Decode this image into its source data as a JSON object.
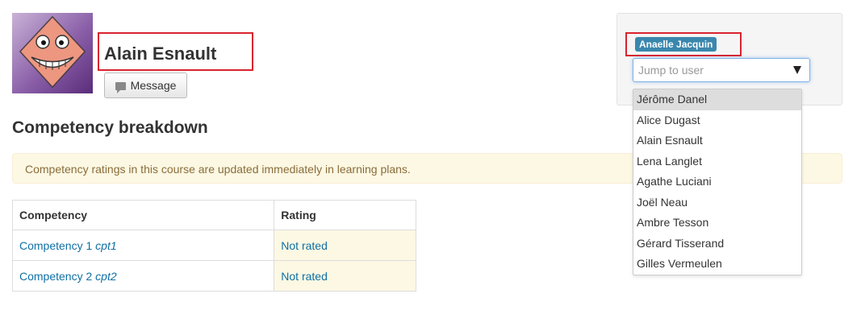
{
  "user": {
    "name": "Alain Esnault"
  },
  "message_button": {
    "label": "Message"
  },
  "section_title": "Competency breakdown",
  "alert_text": "Competency ratings in this course are updated immediately in learning plans.",
  "table": {
    "headers": [
      "Competency",
      "Rating"
    ],
    "rows": [
      {
        "name": "Competency 1",
        "id": "cpt1",
        "rating": "Not rated"
      },
      {
        "name": "Competency 2",
        "id": "cpt2",
        "rating": "Not rated"
      }
    ]
  },
  "user_switcher": {
    "badge": "Anaelle Jacquin",
    "placeholder": "Jump to user",
    "options": [
      "Jérôme Danel",
      "Alice Dugast",
      "Alain Esnault",
      "Lena Langlet",
      "Agathe Luciani",
      "Joël Neau",
      "Ambre Tesson",
      "Gérard Tisserand",
      "Gilles Vermeulen"
    ],
    "highlighted_index": 0
  },
  "colors": {
    "highlight_border": "#d9232e",
    "link": "#0f6fa5",
    "badge_bg": "#3a87ad",
    "warning_bg": "#fcf8e3"
  },
  "icons": {
    "message": "chat-bubble-icon",
    "dropdown": "caret-down-icon",
    "avatar": "default-avatar-face"
  }
}
